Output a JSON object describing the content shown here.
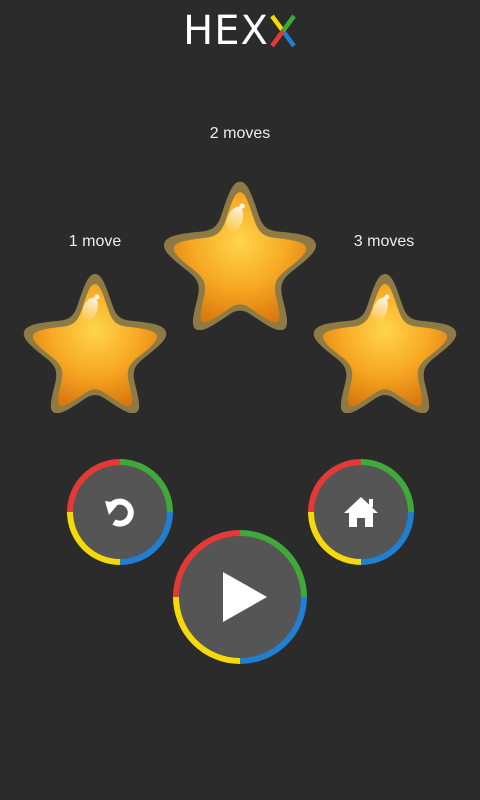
{
  "app": {
    "title_letters": [
      {
        "char": "H",
        "color": "#ffffff"
      },
      {
        "char": "E",
        "color": "#ffffff"
      },
      {
        "char": "X",
        "color": "#ffffff"
      },
      {
        "char": "X",
        "color": "multicolor"
      }
    ]
  },
  "stars": [
    {
      "label": "1 move",
      "earned": true
    },
    {
      "label": "2 moves",
      "earned": true
    },
    {
      "label": "3 moves",
      "earned": true
    }
  ],
  "buttons": {
    "retry": {
      "icon": "retry-icon"
    },
    "home": {
      "icon": "home-icon"
    },
    "play": {
      "icon": "play-icon"
    }
  },
  "colors": {
    "background": "#2b2b2b",
    "button_fill": "#555555",
    "ring_red": "#e53935",
    "ring_green": "#3faa3a",
    "ring_blue": "#1f7fd1",
    "ring_yellow": "#f5d90a",
    "star_gold": "#f7a823"
  }
}
